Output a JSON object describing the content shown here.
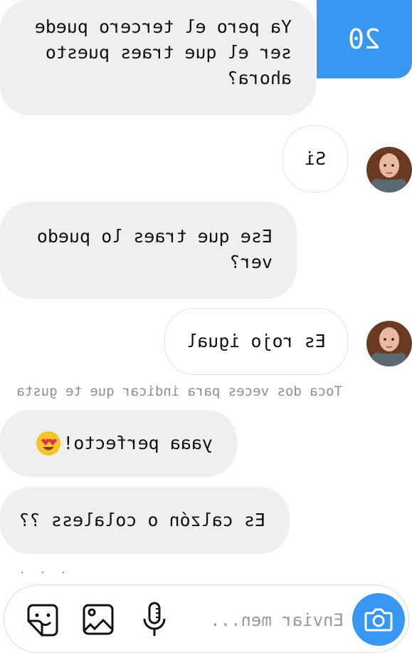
{
  "thread": {
    "counter": "20",
    "messages": [
      {
        "id": "m1",
        "text": "Ya pero el tercero puede ser el que traes puesto ahora?"
      },
      {
        "id": "m2",
        "text": "Si"
      },
      {
        "id": "m3",
        "text": "Ese que traes lo puedo ver?"
      },
      {
        "id": "m4",
        "text": "Es rojo igual"
      },
      {
        "id": "m5",
        "text": "yaaa perfecto!"
      },
      {
        "id": "m6",
        "text": "Es calzón o colaless ??"
      }
    ],
    "like_hint": "Toca dos veces para indicar que te gusta",
    "typing_dots": ". . ."
  },
  "composer": {
    "placeholder": "Enviar men...",
    "icons": [
      "camera-icon",
      "microphone-icon",
      "image-icon",
      "sticker-icon"
    ]
  },
  "colors": {
    "accent": "#3897f0",
    "bubble_gray": "#efefef",
    "hint": "#8e8e8e"
  }
}
